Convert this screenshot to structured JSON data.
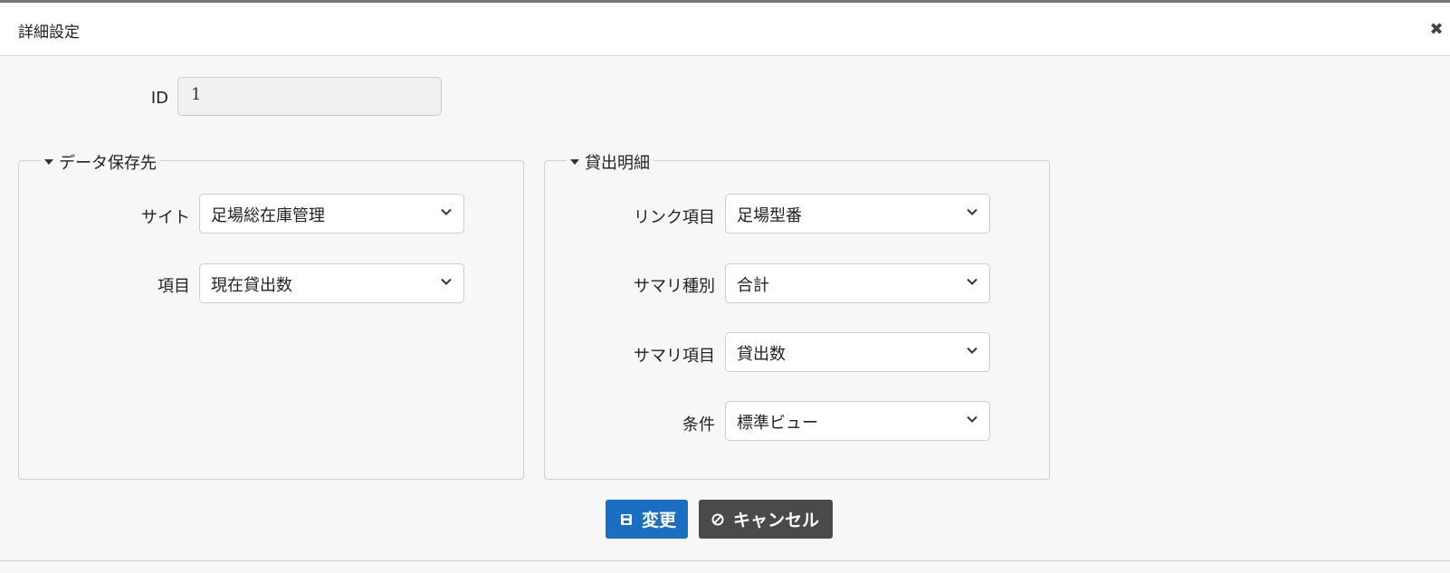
{
  "dialog": {
    "title": "詳細設定",
    "close_icon": "close-icon"
  },
  "id_field": {
    "label": "ID",
    "value": "1"
  },
  "data_store": {
    "legend": "データ保存先",
    "site_label": "サイト",
    "site_value": "足場総在庫管理",
    "item_label": "項目",
    "item_value": "現在貸出数"
  },
  "loan_detail": {
    "legend": "貸出明細",
    "link_label": "リンク項目",
    "link_value": "足場型番",
    "summary_type_label": "サマリ種別",
    "summary_type_value": "合計",
    "summary_item_label": "サマリ項目",
    "summary_item_value": "貸出数",
    "condition_label": "条件",
    "condition_value": "標準ビュー"
  },
  "actions": {
    "save_label": "変更",
    "cancel_label": "キャンセル"
  },
  "colors": {
    "primary": "#1a6fc2",
    "secondary": "#4a4a4a"
  }
}
